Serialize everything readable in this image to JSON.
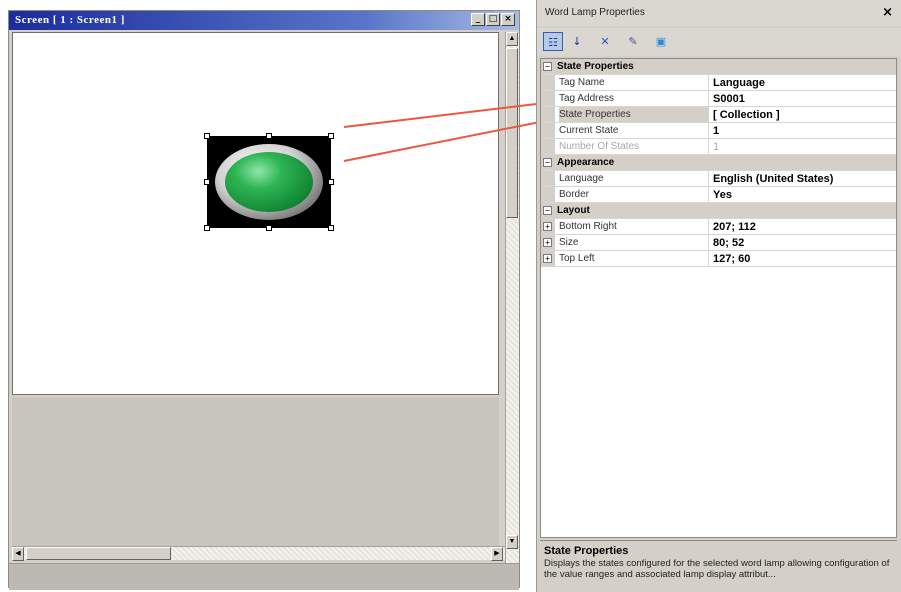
{
  "designer": {
    "title": "Screen [ 1 : Screen1 ]",
    "buttons": {
      "minimize": "_",
      "maximize": "□",
      "close": "×"
    }
  },
  "properties_panel": {
    "title": "Word Lamp Properties",
    "close_glyph": "×",
    "toolbar": [
      {
        "name": "categorized-icon",
        "glyph": "☷"
      },
      {
        "name": "alphabetical-icon",
        "glyph": "↓"
      },
      {
        "name": "expand-icon",
        "glyph": "✕"
      },
      {
        "name": "wand-icon",
        "glyph": "✎"
      },
      {
        "name": "pages-icon",
        "glyph": "▣"
      }
    ],
    "categories": [
      {
        "label": "State Properties",
        "expander": "−",
        "rows": [
          {
            "name": "Tag Name",
            "value": "Language"
          },
          {
            "name": "Tag Address",
            "value": "S0001"
          },
          {
            "name": "State Properties",
            "value": "[ Collection ]"
          },
          {
            "name": "Current State",
            "value": "1"
          },
          {
            "name": "Number Of States",
            "value": "1"
          }
        ]
      },
      {
        "label": "Appearance",
        "expander": "−",
        "rows": [
          {
            "name": "Language",
            "value": "English (United States)"
          },
          {
            "name": "Border",
            "value": "Yes"
          }
        ]
      },
      {
        "label": "Layout",
        "expander": "−",
        "rows": [
          {
            "name": "Bottom Right",
            "value": "207; 112",
            "expander": "+"
          },
          {
            "name": "Size",
            "value": "80; 52",
            "expander": "+"
          },
          {
            "name": "Top Left",
            "value": "127; 60",
            "expander": "+"
          }
        ]
      }
    ],
    "help": {
      "title": "State Properties",
      "text": "Displays the states configured for the selected word lamp allowing configuration of the value ranges and associated lamp display attribut..."
    }
  },
  "colors": {
    "title_bar_start": "#1c2c9c",
    "lamp_green": "#2fb554",
    "connector_line": "#f0563e"
  }
}
